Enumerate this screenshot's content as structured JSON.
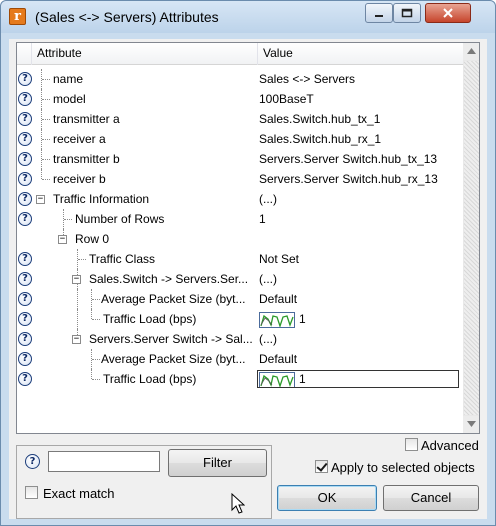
{
  "window": {
    "title": "(Sales <-> Servers) Attributes",
    "app_icon_letter": "r"
  },
  "grid": {
    "columns": {
      "attribute": "Attribute",
      "value": "Value"
    },
    "rows": [
      {
        "name": "name",
        "value": "Sales <-> Servers",
        "help": true
      },
      {
        "name": "model",
        "value": "100BaseT",
        "help": true
      },
      {
        "name": "transmitter a",
        "value": "Sales.Switch.hub_tx_1",
        "help": true
      },
      {
        "name": "receiver a",
        "value": "Sales.Switch.hub_rx_1",
        "help": true
      },
      {
        "name": "transmitter b",
        "value": "Servers.Server Switch.hub_tx_13",
        "help": true
      },
      {
        "name": "receiver b",
        "value": "Servers.Server Switch.hub_rx_13",
        "help": true
      },
      {
        "name": "Traffic Information",
        "value": "(...)",
        "help": true
      },
      {
        "name": "Number of Rows",
        "value": "1",
        "help": true
      },
      {
        "name": "Row 0",
        "value": "",
        "help": false
      },
      {
        "name": "Traffic Class",
        "value": "Not Set",
        "help": true
      },
      {
        "name": "Sales.Switch -> Servers.Ser...",
        "value": "(...)",
        "help": true
      },
      {
        "name": "Average Packet Size (byt...",
        "value": "Default",
        "help": true
      },
      {
        "name": "Traffic Load (bps)",
        "value": "1",
        "help": true
      },
      {
        "name": "Servers.Server Switch -> Sal...",
        "value": "(...)",
        "help": true
      },
      {
        "name": "Average Packet Size (byt...",
        "value": "Default",
        "help": true
      },
      {
        "name": "Traffic Load (bps)",
        "value": "1",
        "help": true
      }
    ]
  },
  "filter": {
    "input_value": "",
    "button_label": "Filter",
    "exact_match_label": "Exact match",
    "exact_match_checked": false
  },
  "options": {
    "advanced_label": "Advanced",
    "advanced_checked": false,
    "apply_label": "Apply to selected objects",
    "apply_checked": true
  },
  "buttons": {
    "ok": "OK",
    "cancel": "Cancel"
  },
  "colors": {
    "title_bar": "#bcd3ea",
    "close_button": "#c6452c",
    "app_icon": "#e57a1c",
    "sparkline": "#2a9a2a"
  }
}
